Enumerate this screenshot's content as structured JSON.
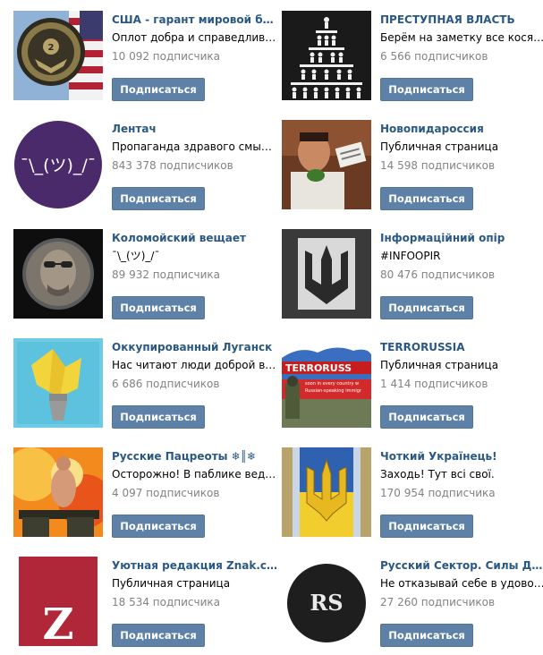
{
  "accent_color": "#2a5885",
  "button_color": "#5e81a8",
  "communities": [
    {
      "title": "США - гарант мировой безопасности",
      "description": "Оплот добра и справедливости",
      "subscribers": "10 092 подписчика",
      "button_label": "Подписаться",
      "thumb": "usa-seal"
    },
    {
      "title": "ПРЕСТУПНАЯ ВЛАСТЬ",
      "description": "Берём на заметку все косяки",
      "subscribers": "6 566 подписчиков",
      "button_label": "Подписаться",
      "thumb": "pyramid"
    },
    {
      "title": "Лентач",
      "description": "Пропаганда здравого смысла",
      "subscribers": "843 378 подписчиков",
      "button_label": "Подписаться",
      "thumb": "lentach",
      "thumb_text": "¯\\_(ツ)_/¯"
    },
    {
      "title": "Новопидароссия",
      "description": "Публичная страница",
      "subscribers": "14 598 подписчиков",
      "button_label": "Подписаться",
      "thumb": "photo-man"
    },
    {
      "title": "Коломойский вещает",
      "description": "¯\\_(ツ)_/¯",
      "subscribers": "89 932 подписчика",
      "button_label": "Подписаться",
      "thumb": "portrait-circle"
    },
    {
      "title": "Інформаційний опір",
      "description": "#INFOOPIR",
      "subscribers": "80 476 подписчиков",
      "button_label": "Подписаться",
      "thumb": "trident-dark"
    },
    {
      "title": "Оккупированный Луганск",
      "description": "Нас читают люди доброй воли",
      "subscribers": "6 686 подписчиков",
      "button_label": "Подписаться",
      "thumb": "torch"
    },
    {
      "title": "TERRORUSSIA",
      "description": "Публичная страница",
      "subscribers": "1 414 подписчиков",
      "button_label": "Подписаться",
      "thumb": "terrorussia",
      "thumb_text": "TERRORUSS",
      "thumb_sub1": "soon in every country w",
      "thumb_sub2": "Russian-speaking immigr"
    },
    {
      "title": "Русские Пацреоты ❄║❄",
      "description": "Осторожно! В паблике ведутся",
      "subscribers": "4 097 подписчиков",
      "button_label": "Подписаться",
      "thumb": "explosion"
    },
    {
      "title": "Чоткий Українець!",
      "description": "Заходь! Тут всі свої.",
      "subscribers": "170 954 подписчика",
      "button_label": "Подписаться",
      "thumb": "trident-flag"
    },
    {
      "title": "Уютная редакция Znak.com",
      "description": "Публичная страница",
      "subscribers": "18 534 подписчика",
      "button_label": "Подписаться",
      "thumb": "znak",
      "thumb_text": "Z"
    },
    {
      "title": "Русский Сектор. Силы Добра",
      "description": "Не отказывай себе в удовольствии",
      "subscribers": "27 260 подписчиков",
      "button_label": "Подписаться",
      "thumb": "rs",
      "thumb_text": "RS"
    }
  ]
}
